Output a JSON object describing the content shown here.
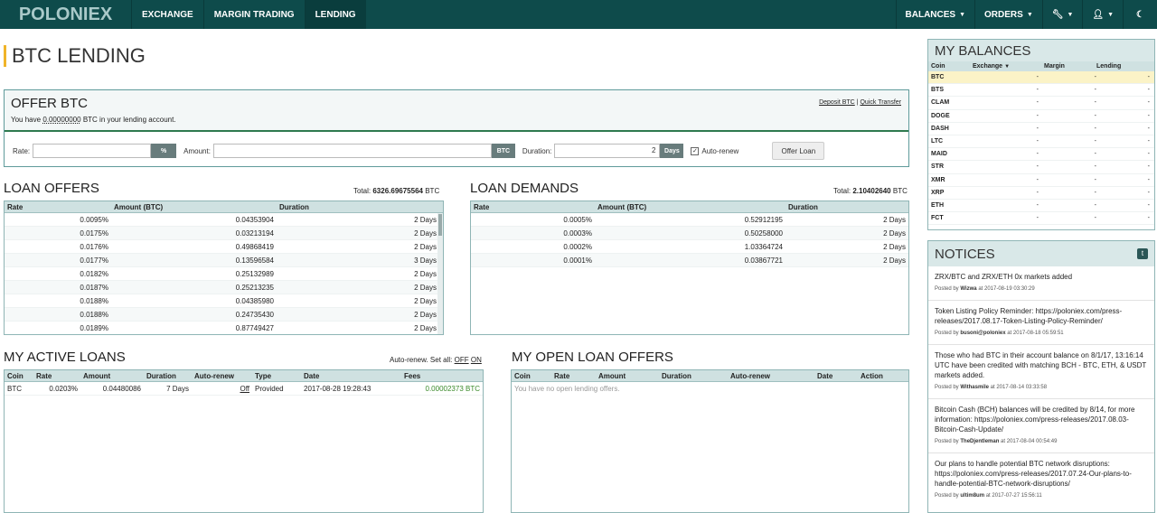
{
  "nav": {
    "logo": "POLONIEX",
    "items": [
      {
        "label": "EXCHANGE"
      },
      {
        "label": "MARGIN TRADING"
      },
      {
        "label": "LENDING"
      }
    ],
    "right": [
      {
        "label": "BALANCES"
      },
      {
        "label": "ORDERS"
      }
    ]
  },
  "page": {
    "title": "BTC LENDING"
  },
  "offer": {
    "title": "OFFER BTC",
    "sub_prefix": "You have",
    "sub_amount": "0.00000000",
    "sub_suffix": "BTC in your lending account.",
    "deposit_link": "Deposit BTC",
    "sep": "|",
    "transfer_link": "Quick Transfer",
    "rate_label": "Rate:",
    "rate_addon": "%",
    "amount_label": "Amount:",
    "amount_addon": "BTC",
    "duration_label": "Duration:",
    "duration_value": "2",
    "duration_addon": "Days",
    "autorenew_label": "Auto-renew",
    "submit_label": "Offer Loan"
  },
  "loan_offers": {
    "title": "LOAN OFFERS",
    "total_label": "Total:",
    "total_value": "6326.69675564",
    "total_unit": "BTC",
    "columns": [
      "Rate",
      "Amount (BTC)",
      "Duration"
    ],
    "rows": [
      [
        "0.0095%",
        "0.04353904",
        "2 Days"
      ],
      [
        "0.0175%",
        "0.03213194",
        "2 Days"
      ],
      [
        "0.0176%",
        "0.49868419",
        "2 Days"
      ],
      [
        "0.0177%",
        "0.13596584",
        "3 Days"
      ],
      [
        "0.0182%",
        "0.25132989",
        "2 Days"
      ],
      [
        "0.0187%",
        "0.25213235",
        "2 Days"
      ],
      [
        "0.0188%",
        "0.04385980",
        "2 Days"
      ],
      [
        "0.0188%",
        "0.24735430",
        "2 Days"
      ],
      [
        "0.0189%",
        "0.87749427",
        "2 Days"
      ]
    ]
  },
  "loan_demands": {
    "title": "LOAN DEMANDS",
    "total_label": "Total:",
    "total_value": "2.10402640",
    "total_unit": "BTC",
    "columns": [
      "Rate",
      "Amount (BTC)",
      "Duration"
    ],
    "rows": [
      [
        "0.0005%",
        "0.52912195",
        "2 Days"
      ],
      [
        "0.0003%",
        "0.50258000",
        "2 Days"
      ],
      [
        "0.0002%",
        "1.03364724",
        "2 Days"
      ],
      [
        "0.0001%",
        "0.03867721",
        "2 Days"
      ]
    ]
  },
  "active_loans": {
    "title": "MY ACTIVE LOANS",
    "setall_label": "Auto-renew. Set all:",
    "off": "OFF",
    "on": "ON",
    "columns": [
      "Coin",
      "Rate",
      "Amount",
      "Duration",
      "Auto-renew",
      "Type",
      "Date",
      "Fees"
    ],
    "rows": [
      [
        "BTC",
        "0.0203%",
        "0.04480086",
        "7 Days",
        "Off",
        "Provided",
        "2017-08-28 19:28:43",
        "0.00002373 BTC"
      ]
    ]
  },
  "open_offers": {
    "title": "MY OPEN LOAN OFFERS",
    "columns": [
      "Coin",
      "Rate",
      "Amount",
      "Duration",
      "Auto-renew",
      "Date",
      "Action"
    ],
    "empty": "You have no open lending offers."
  },
  "balances": {
    "title": "MY BALANCES",
    "columns": [
      "Coin",
      "Exchange",
      "Margin",
      "Lending"
    ],
    "rows": [
      [
        "BTC",
        "-",
        "-",
        "-"
      ],
      [
        "BTS",
        "-",
        "-",
        "-"
      ],
      [
        "CLAM",
        "-",
        "-",
        "-"
      ],
      [
        "DOGE",
        "-",
        "-",
        "-"
      ],
      [
        "DASH",
        "-",
        "-",
        "-"
      ],
      [
        "LTC",
        "-",
        "-",
        "-"
      ],
      [
        "MAID",
        "-",
        "-",
        "-"
      ],
      [
        "STR",
        "-",
        "-",
        "-"
      ],
      [
        "XMR",
        "-",
        "-",
        "-"
      ],
      [
        "XRP",
        "-",
        "-",
        "-"
      ],
      [
        "ETH",
        "-",
        "-",
        "-"
      ],
      [
        "FCT",
        "-",
        "-",
        "-"
      ]
    ]
  },
  "notices": {
    "title": "NOTICES",
    "posted_by": "Posted by",
    "at": "at",
    "items": [
      {
        "text": "ZRX/BTC and ZRX/ETH 0x markets added",
        "author": "Wizwa",
        "date": "2017-08-19 03:30:29"
      },
      {
        "text": "Token Listing Policy Reminder: https://poloniex.com/press-releases/2017.08.17-Token-Listing-Policy-Reminder/",
        "author": "busoni@poloniex",
        "date": "2017-08-18 05:59:51"
      },
      {
        "text": "Those who had BTC in their account balance on 8/1/17, 13:16:14 UTC have been credited with matching BCH - BTC, ETH, & USDT markets added.",
        "author": "Withasmile",
        "date": "2017-08-14 03:33:58"
      },
      {
        "text": "Bitcoin Cash (BCH) balances will be credited by 8/14, for more information: https://poloniex.com/press-releases/2017.08.03-Bitcoin-Cash-Update/",
        "author": "TheDjentleman",
        "date": "2017-08-04 00:54:49"
      },
      {
        "text": "Our plans to handle potential BTC network disruptions: https://poloniex.com/press-releases/2017.07.24-Our-plans-to-handle-potential-BTC-network-disruptions/",
        "author": "ultim8um",
        "date": "2017-07-27 15:56:11"
      }
    ]
  }
}
